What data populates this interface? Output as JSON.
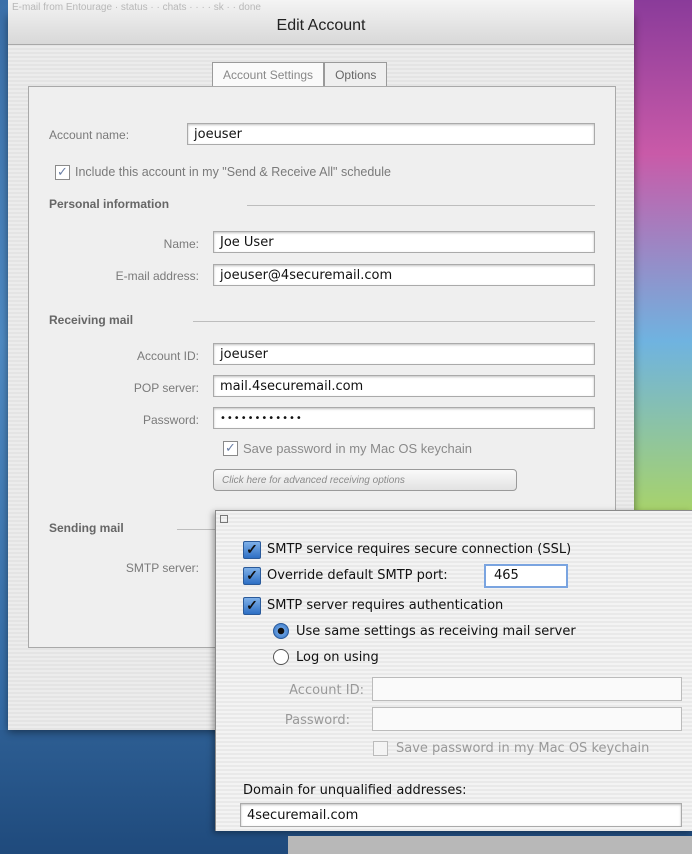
{
  "window": {
    "title": "Edit Account",
    "ghost_title": "E-mail from Entourage · status · · chats · · · · sk · · done"
  },
  "tabs": [
    {
      "label": "Account Settings",
      "selected": true
    },
    {
      "label": "Options",
      "selected": false
    }
  ],
  "account": {
    "name_label": "Account name:",
    "name_value": "joeuser",
    "include_label": "Include this account in my \"Send & Receive All\" schedule",
    "include_checked": true
  },
  "personal": {
    "heading": "Personal information",
    "name_label": "Name:",
    "name_value": "Joe User",
    "email_label": "E-mail address:",
    "email_value": "joeuser@4securemail.com"
  },
  "receiving": {
    "heading": "Receiving mail",
    "account_id_label": "Account ID:",
    "account_id_value": "joeuser",
    "pop_label": "POP server:",
    "pop_value": "mail.4securemail.com",
    "password_label": "Password:",
    "password_value": "••••••••••••",
    "save_pw_label": "Save password in my Mac OS keychain",
    "save_pw_checked": true,
    "advanced_button": "Click here for advanced receiving options"
  },
  "sending": {
    "heading": "Sending mail",
    "smtp_label": "SMTP server:"
  },
  "smtp_dialog": {
    "ssl_label": "SMTP service requires secure connection (SSL)",
    "ssl_checked": true,
    "override_label": "Override default SMTP port:",
    "override_checked": true,
    "port_value": "465",
    "auth_label": "SMTP server requires authentication",
    "auth_checked": true,
    "radio_same_label": "Use same settings as receiving mail server",
    "radio_logon_label": "Log on using",
    "selected_radio": "same",
    "account_id_label": "Account ID:",
    "password_label": "Password:",
    "save_pw_label": "Save password in my Mac OS keychain",
    "save_pw_checked": false,
    "domain_label": "Domain for unqualified addresses:",
    "domain_value": "4securemail.com"
  }
}
